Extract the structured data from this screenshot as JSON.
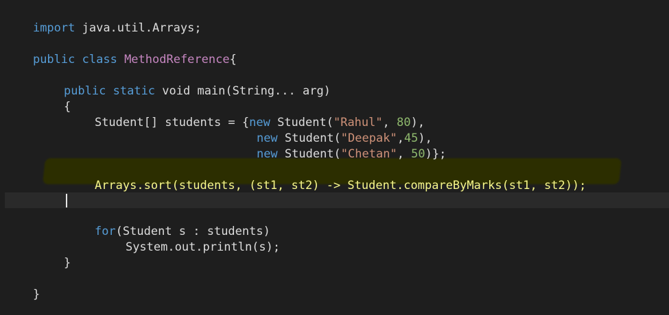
{
  "editor": {
    "lines": {
      "l1": {
        "kw": "import",
        "rest": " java.util.Arrays;"
      },
      "l2": {
        "kw1": "public",
        "kw2": "class",
        "cls": "MethodReference",
        "brace": "{"
      },
      "l3": {
        "kw1": "public",
        "kw2": "static",
        "rest": " void main(String... arg)"
      },
      "l4": {
        "brace": "{"
      },
      "l5": {
        "pre": "Student[] students = {",
        "kw": "new",
        "type": " Student(",
        "str": "\"Rahul\"",
        "sep": ", ",
        "num": "80",
        "post": "),"
      },
      "l6": {
        "kw": "new",
        "type": " Student(",
        "str": "\"Deepak\"",
        "sep": ",",
        "num": "45",
        "post": "),"
      },
      "l7": {
        "kw": "new",
        "type": " Student(",
        "str": "\"Chetan\"",
        "sep": ", ",
        "num": "50",
        "post": ")};"
      },
      "l8": {
        "text": "Arrays.sort(students, (st1, st2) -> Student.compareByMarks(st1, st2));"
      },
      "l9": {
        "kw": "for",
        "rest": "(Student s : students)"
      },
      "l10": {
        "text": "System.out.println(s);"
      },
      "l11": {
        "brace": "}"
      },
      "l12": {
        "brace": "}"
      }
    },
    "colors": {
      "background": "#1e1e1e",
      "keyword": "#569cd6",
      "class_name": "#c586c0",
      "string": "#ce9178",
      "number": "#8fb96d",
      "highlighted_text": "#f7f78a"
    }
  }
}
